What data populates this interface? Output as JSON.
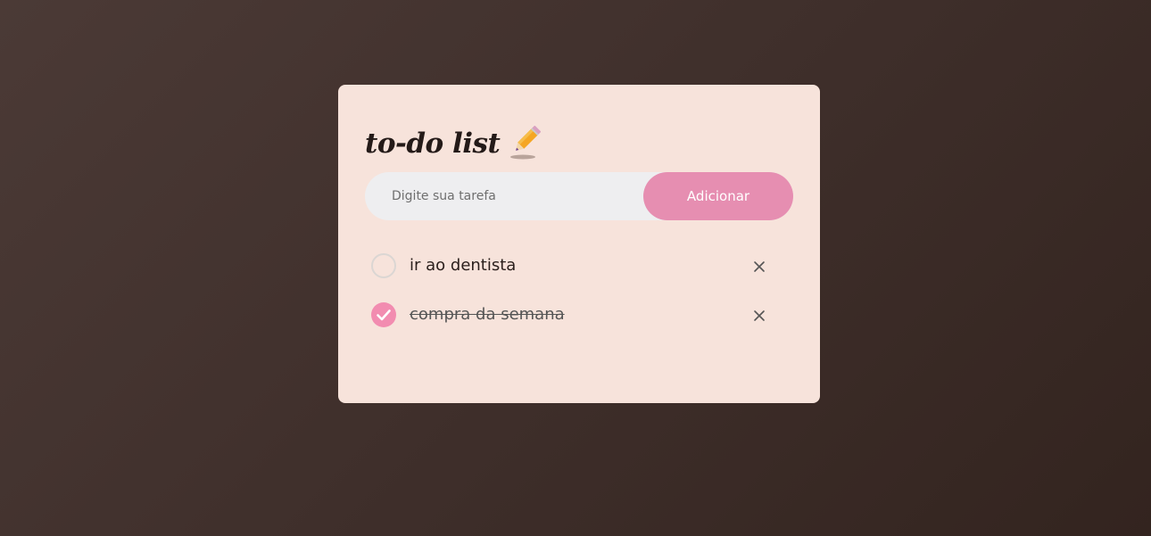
{
  "app": {
    "title": "to-do list",
    "title_icon": "pencil-icon"
  },
  "input": {
    "placeholder": "Digite sua tarefa",
    "value": ""
  },
  "add_button": {
    "label": "Adicionar"
  },
  "tasks": [
    {
      "text": "ir ao dentista",
      "completed": false
    },
    {
      "text": "compra da semana",
      "completed": true
    }
  ],
  "colors": {
    "card_background": "#f7e3db",
    "accent": "#e68eb1",
    "check_fill": "#f28cb0",
    "input_background": "#eeeef0"
  },
  "icons": {
    "delete": "close-icon",
    "check": "checkmark-icon"
  }
}
